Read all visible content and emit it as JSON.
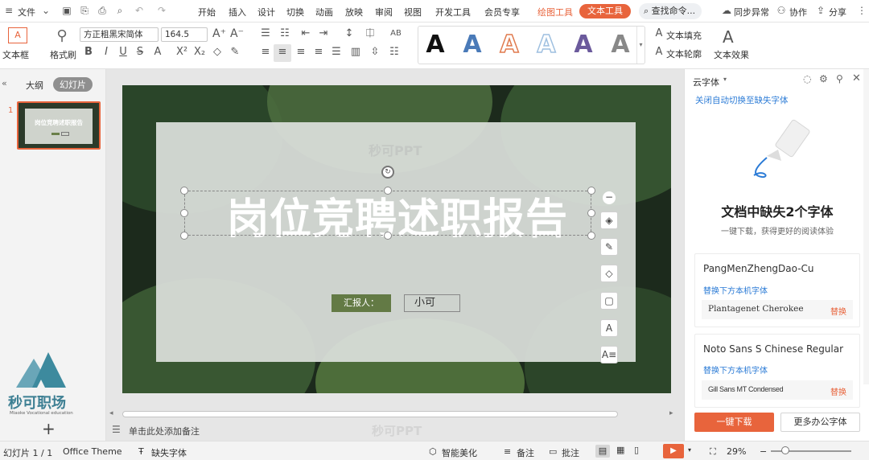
{
  "menubar": {
    "file_label": "文件",
    "tabs": [
      "开始",
      "插入",
      "设计",
      "切换",
      "动画",
      "放映",
      "审阅",
      "视图",
      "开发工具",
      "会员专享"
    ],
    "active_tab_drawing": "绘图工具",
    "active_tab_text": "文本工具",
    "search_label": "查找命令...",
    "sync_label": "同步异常",
    "collab_label": "协作",
    "share_label": "分享"
  },
  "ribbon": {
    "textbox_label": "文本框",
    "format_brush_label": "格式刷",
    "font_name": "方正粗黑宋简体",
    "font_size": "164.5",
    "text_fill_label": "文本填充",
    "text_outline_label": "文本轮廓",
    "text_effects_label": "文本效果",
    "gallery_letters": [
      "A",
      "A",
      "A",
      "A",
      "A",
      "A"
    ],
    "gallery_colors": [
      "#111111",
      "#4a7ab8",
      "#e07b4f",
      "#9fc0e0",
      "#6b5a9c",
      "#888888"
    ]
  },
  "leftpanel": {
    "tab_outline": "大纲",
    "tab_slides": "幻灯片",
    "slide_number": "1",
    "thumb_title": "岗位竞聘述职报告",
    "logo_text": "秒可职场",
    "logo_sub": "Miaoke Vocational education"
  },
  "slide": {
    "watermark": "秒可PPT",
    "title": "岗位竞聘述职报告",
    "reporter_label": "汇报人：",
    "reporter_name": "小可"
  },
  "canvas": {
    "notes_placeholder": "单击此处添加备注",
    "watermark_bottom": "秒可PPT"
  },
  "rightpanel": {
    "header": "云字体",
    "auto_switch_link": "关闭自动切换至缺失字体",
    "missing_title": "文档中缺失2个字体",
    "missing_sub": "一键下载，获得更好的阅读体验",
    "fonts": [
      {
        "name": "PangMenZhengDao-Cu",
        "replace_hint": "替换下方本机字体",
        "local_font": "Plantagenet Cherokee",
        "replace_btn": "替换"
      },
      {
        "name": "Noto Sans S Chinese Regular",
        "replace_hint": "替换下方本机字体",
        "local_font": "Gill Sans MT Condensed",
        "replace_btn": "替换"
      }
    ],
    "download_btn": "一键下载",
    "more_fonts_btn": "更多办公字体"
  },
  "statusbar": {
    "slide_count": "幻灯片 1 / 1",
    "theme": "Office Theme",
    "missing_font": "缺失字体",
    "smart_beautify": "智能美化",
    "notes": "备注",
    "comments": "批注",
    "zoom": "29%"
  },
  "colors": {
    "accent": "#e8643c",
    "link": "#2b7bd6"
  }
}
